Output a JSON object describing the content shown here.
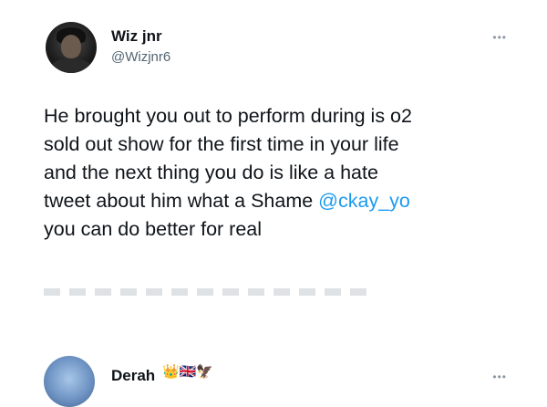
{
  "tweet": {
    "display_name": "Wiz jnr",
    "handle": "@Wizjnr6",
    "more_label": "•••",
    "text_before": "He brought you out to perform during is o2\nsold out show for the first time in your life\nand the next thing you do is like a hate\ntweet about him what a Shame ",
    "mention": "@ckay_yo",
    "text_after": "\nyou can do better for real"
  },
  "reply": {
    "display_name": "Derah",
    "emojis": "👑🇬🇧🦅",
    "more_label": "•••"
  },
  "colors": {
    "link": "#1d9bf0",
    "secondary_text": "#536471",
    "primary_text": "#0f1419"
  }
}
